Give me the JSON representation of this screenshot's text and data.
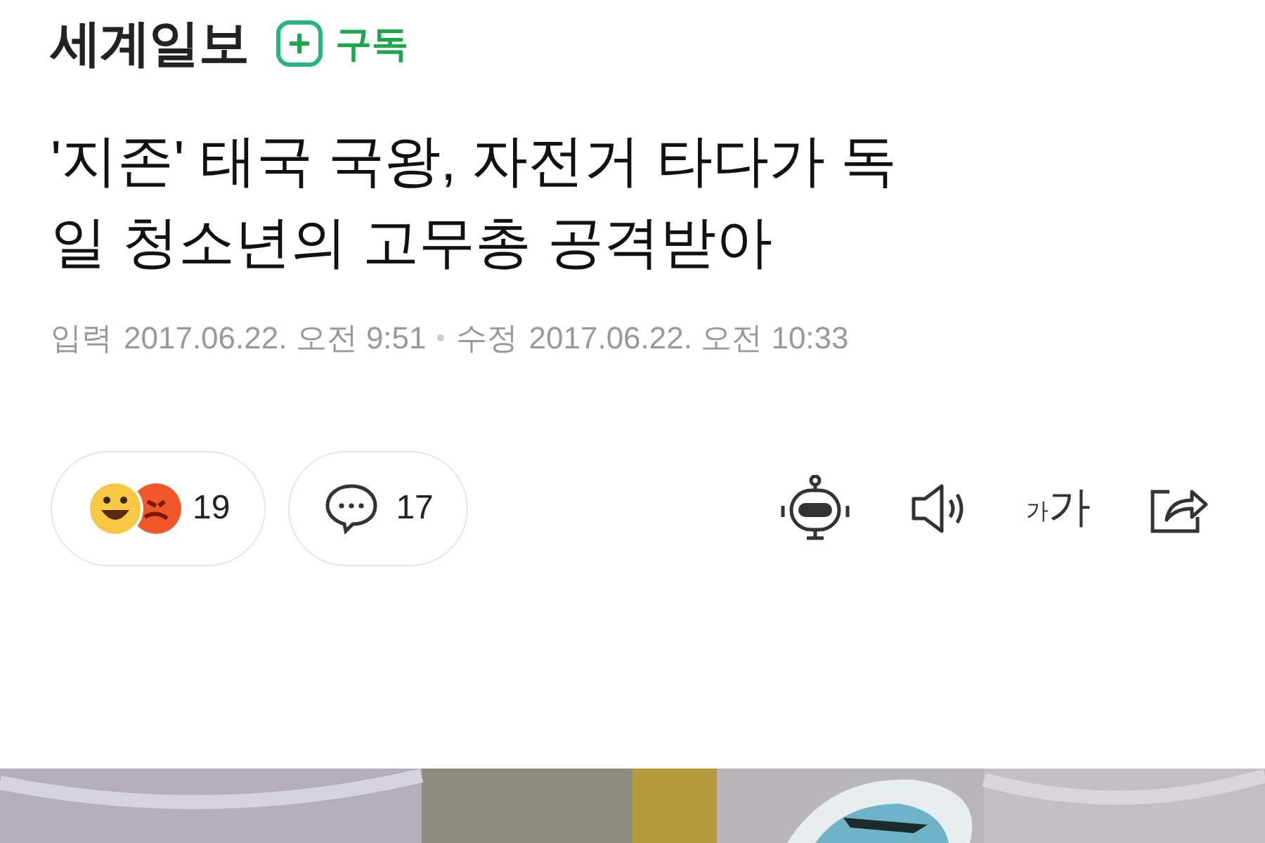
{
  "header": {
    "logo": "세계일보",
    "subscribe": "구독"
  },
  "headline": {
    "lines": [
      "'지존' 태국 국왕, 자전거 타다가 독",
      "일 청소년의 고무총 공격받아"
    ]
  },
  "dates": [
    {
      "label": "입력",
      "value": "2017.06.22. 오전 9:51"
    },
    {
      "label": "수정",
      "value": "2017.06.22. 오전 10:33"
    }
  ],
  "reactions": {
    "count": "19"
  },
  "comments": {
    "count": "17"
  },
  "tools": {
    "font_small": "가",
    "font_large": "가"
  }
}
